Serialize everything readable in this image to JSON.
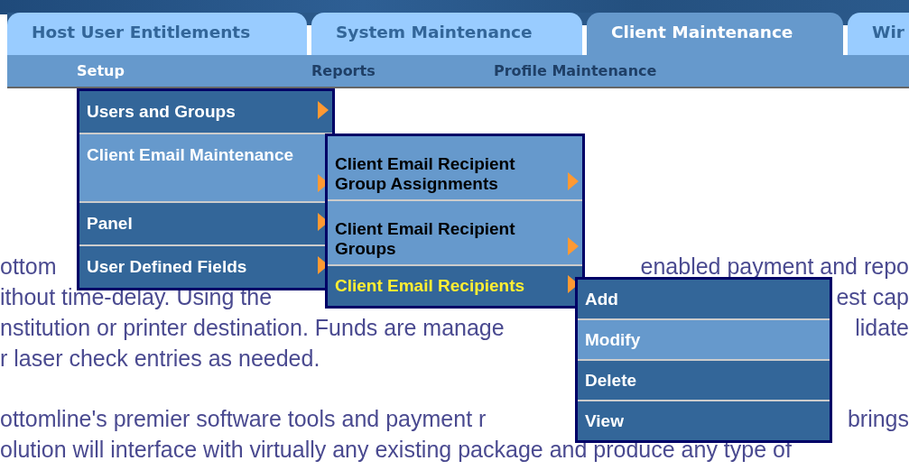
{
  "tabs": [
    {
      "label": "Host User Entitlements",
      "selected": false
    },
    {
      "label": "System Maintenance",
      "selected": false
    },
    {
      "label": "Client Maintenance",
      "selected": true
    },
    {
      "label": "Wir",
      "selected": false
    }
  ],
  "subnav": [
    {
      "label": "Setup",
      "selected": true
    },
    {
      "label": "Reports",
      "selected": false
    },
    {
      "label": "Profile Maintenance",
      "selected": false
    }
  ],
  "body_lines": [
    {
      "left": "ottom",
      "right": "enabled payment and repo"
    },
    {
      "left": "ithout time-delay. Using the",
      "right": "est cap"
    },
    {
      "left": "nstitution or printer destination. Funds are manage",
      "right": "lidate"
    },
    {
      "left": "r laser check entries as needed."
    },
    {
      "left": "ottomline's premier software tools and payment r",
      "right": "brings"
    },
    {
      "left": "olution will interface with virtually any existing package and produce any type of"
    }
  ],
  "menus": [
    {
      "kind": "dark",
      "items": [
        {
          "label": "Users and Groups",
          "submenu": true,
          "selected": false
        },
        {
          "label": "Client Email Maintenance",
          "submenu": true,
          "selected": true
        },
        {
          "label": "Panel",
          "submenu": true,
          "selected": false
        },
        {
          "label": "User Defined Fields",
          "submenu": true,
          "selected": false
        }
      ]
    },
    {
      "kind": "light",
      "items": [
        {
          "label": "Client Email Recipient Group Assignments",
          "submenu": true,
          "selected": false
        },
        {
          "label": "Client Email Recipient Groups",
          "submenu": true,
          "selected": false
        },
        {
          "label": "Client Email Recipients",
          "submenu": true,
          "selected": true
        }
      ]
    },
    {
      "kind": "dark",
      "items": [
        {
          "label": "Add",
          "submenu": false,
          "selected": false
        },
        {
          "label": "Modify",
          "submenu": false,
          "selected": true
        },
        {
          "label": "Delete",
          "submenu": false,
          "selected": false
        },
        {
          "label": "View",
          "submenu": false,
          "selected": false
        }
      ]
    }
  ]
}
